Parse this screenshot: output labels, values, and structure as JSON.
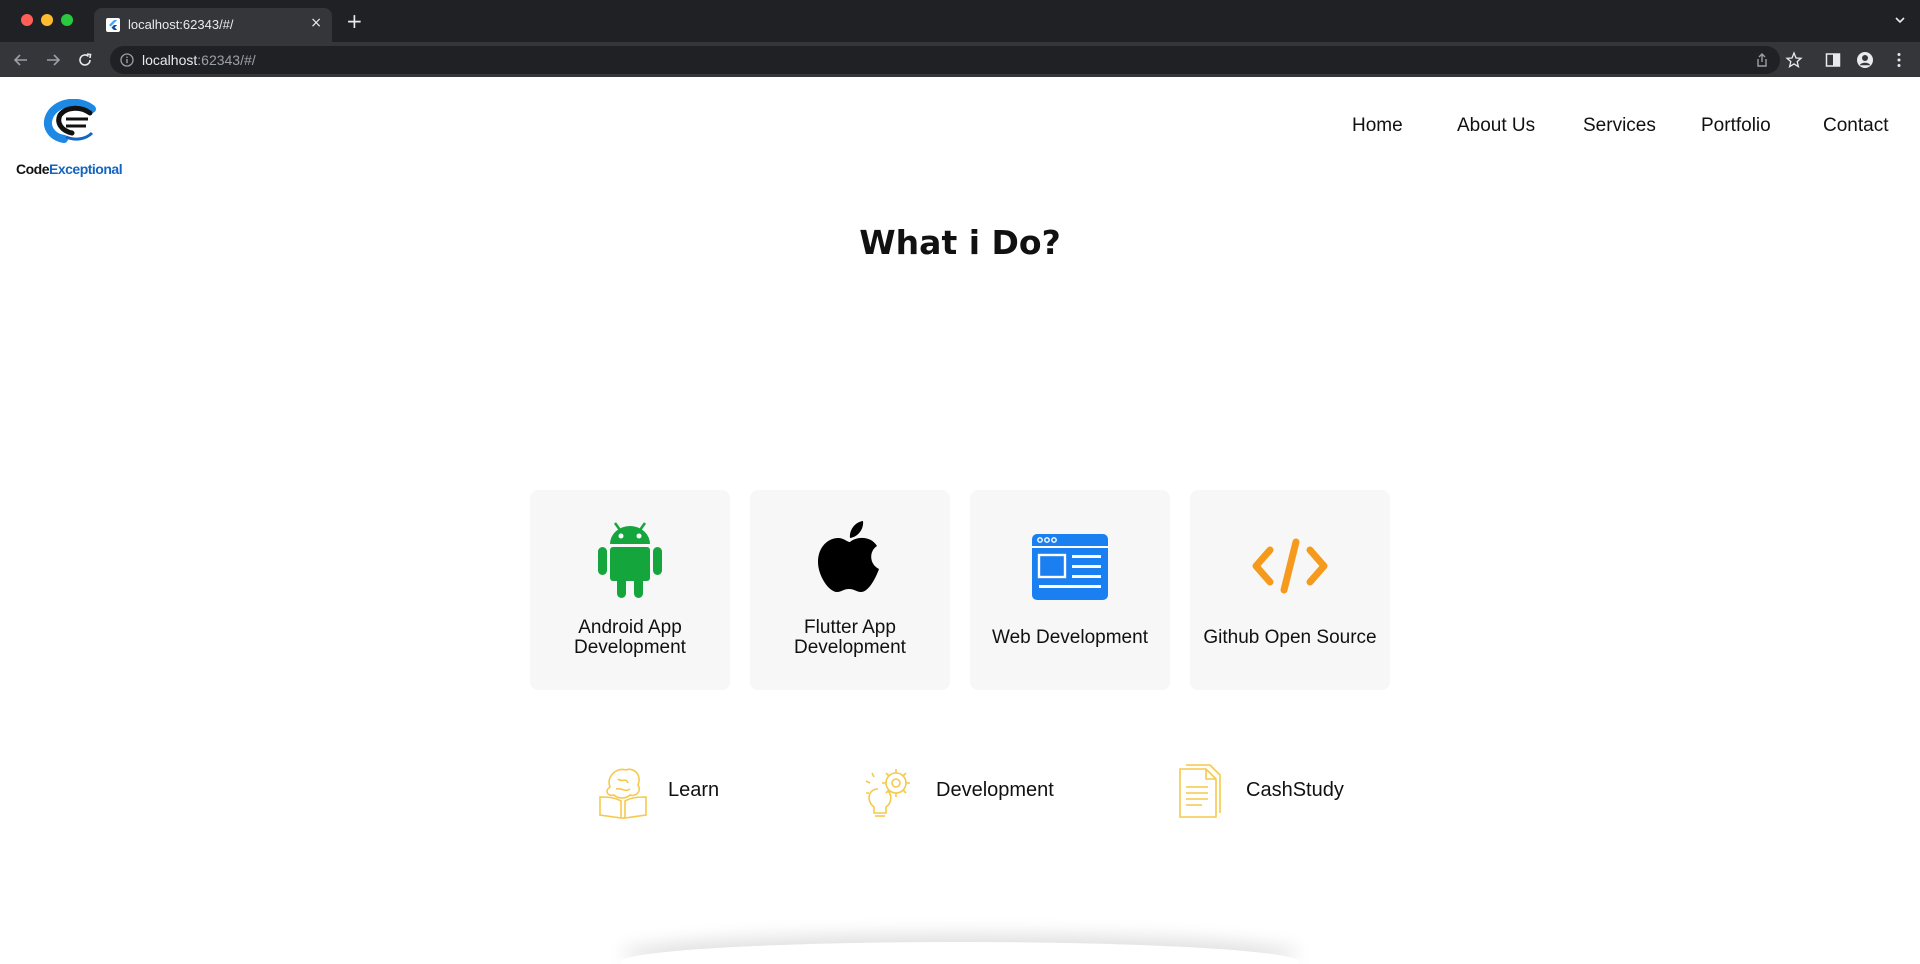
{
  "browser": {
    "tab_title": "localhost:62343/#/",
    "url_host": "localhost",
    "url_rest": ":62343/#/",
    "new_tab_glyph": "+",
    "close_glyph": "×"
  },
  "site": {
    "logo": {
      "code": "Code",
      "exceptional": "Exceptional"
    },
    "nav": [
      "Home",
      "About Us",
      "Services",
      "Portfolio",
      "Contact"
    ]
  },
  "section": {
    "title": "What i Do?"
  },
  "services": [
    {
      "icon": "android-icon",
      "line1": "Android App",
      "line2": "Development",
      "color": "#14a63c"
    },
    {
      "icon": "apple-icon",
      "line1": "Flutter App",
      "line2": "Development",
      "color": "#000000"
    },
    {
      "icon": "web-page-icon",
      "line1": "Web Development",
      "line2": "",
      "color": "#1a7ff0"
    },
    {
      "icon": "code-icon",
      "line1": "Github Open Source",
      "line2": "",
      "color": "#f59a1c"
    }
  ],
  "features": [
    {
      "icon": "book-brain-icon",
      "label": "Learn"
    },
    {
      "icon": "gear-bulb-icon",
      "label": "Development"
    },
    {
      "icon": "document-icon",
      "label": "CashStudy"
    }
  ],
  "colors": {
    "feature_icon": "#f5c94a",
    "logo_blue": "#1565c0"
  }
}
